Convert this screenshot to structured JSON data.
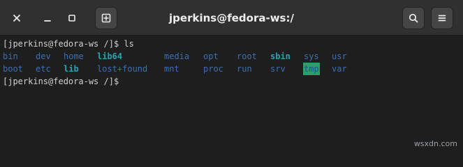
{
  "window": {
    "title": "jperkins@fedora-ws:/"
  },
  "headerbar": {
    "close_icon": "close-icon",
    "minimize_icon": "minimize-icon",
    "maximize_icon": "maximize-icon",
    "new_tab_icon": "new-tab-icon",
    "search_icon": "search-icon",
    "menu_icon": "hamburger-menu-icon"
  },
  "terminal": {
    "prompt1": "[jperkins@fedora-ws /]$ ",
    "command1": "ls",
    "row1": [
      "bin",
      "dev",
      "home",
      "lib64",
      "media",
      "opt",
      "root",
      "sbin",
      "sys",
      "usr"
    ],
    "row2": [
      "boot",
      "etc",
      "lib",
      "lost+found",
      "mnt",
      "proc",
      "run",
      "srv",
      "tmp",
      "var"
    ],
    "prompt2": "[jperkins@fedora-ws /]$ "
  },
  "watermark": "wsxdn.com",
  "colors": {
    "headerbar": "#303030",
    "terminal_bg": "#1e1e1e",
    "directory": "#3b6fb3",
    "symlink": "#2aa1b3",
    "highlight_bg": "#26a269"
  }
}
